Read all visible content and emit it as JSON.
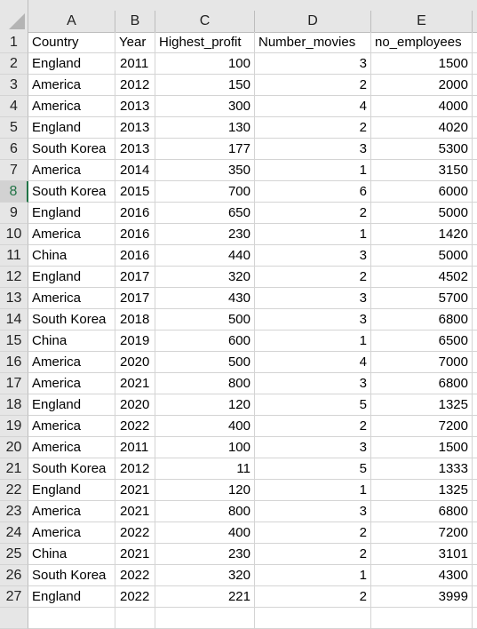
{
  "columns": [
    "A",
    "B",
    "C",
    "D",
    "E"
  ],
  "active_row": 8,
  "headers": [
    "Country",
    "Year",
    "Highest_profit",
    "Number_movies",
    "no_employees"
  ],
  "rows": [
    {
      "n": "2",
      "country": "England",
      "year": "2011",
      "profit": "100",
      "movies": "3",
      "employees": "1500"
    },
    {
      "n": "3",
      "country": "America",
      "year": "2012",
      "profit": "150",
      "movies": "2",
      "employees": "2000"
    },
    {
      "n": "4",
      "country": "America",
      "year": "2013",
      "profit": "300",
      "movies": "4",
      "employees": "4000"
    },
    {
      "n": "5",
      "country": "England",
      "year": "2013",
      "profit": "130",
      "movies": "2",
      "employees": "4020"
    },
    {
      "n": "6",
      "country": "South Korea",
      "year": "2013",
      "profit": "177",
      "movies": "3",
      "employees": "5300"
    },
    {
      "n": "7",
      "country": "America",
      "year": "2014",
      "profit": "350",
      "movies": "1",
      "employees": "3150"
    },
    {
      "n": "8",
      "country": "South Korea",
      "year": "2015",
      "profit": "700",
      "movies": "6",
      "employees": "6000"
    },
    {
      "n": "9",
      "country": "England",
      "year": "2016",
      "profit": "650",
      "movies": "2",
      "employees": "5000"
    },
    {
      "n": "10",
      "country": "America",
      "year": "2016",
      "profit": "230",
      "movies": "1",
      "employees": "1420"
    },
    {
      "n": "11",
      "country": "China",
      "year": "2016",
      "profit": "440",
      "movies": "3",
      "employees": "5000"
    },
    {
      "n": "12",
      "country": "England",
      "year": "2017",
      "profit": "320",
      "movies": "2",
      "employees": "4502"
    },
    {
      "n": "13",
      "country": "America",
      "year": "2017",
      "profit": "430",
      "movies": "3",
      "employees": "5700"
    },
    {
      "n": "14",
      "country": "South Korea",
      "year": "2018",
      "profit": "500",
      "movies": "3",
      "employees": "6800"
    },
    {
      "n": "15",
      "country": "China",
      "year": "2019",
      "profit": "600",
      "movies": "1",
      "employees": "6500"
    },
    {
      "n": "16",
      "country": "America",
      "year": "2020",
      "profit": "500",
      "movies": "4",
      "employees": "7000"
    },
    {
      "n": "17",
      "country": "America",
      "year": "2021",
      "profit": "800",
      "movies": "3",
      "employees": "6800"
    },
    {
      "n": "18",
      "country": "England",
      "year": "2020",
      "profit": "120",
      "movies": "5",
      "employees": "1325"
    },
    {
      "n": "19",
      "country": "America",
      "year": "2022",
      "profit": "400",
      "movies": "2",
      "employees": "7200"
    },
    {
      "n": "20",
      "country": "America",
      "year": "2011",
      "profit": "100",
      "movies": "3",
      "employees": "1500"
    },
    {
      "n": "21",
      "country": "South Korea",
      "year": "2012",
      "profit": "11",
      "movies": "5",
      "employees": "1333"
    },
    {
      "n": "22",
      "country": "England",
      "year": "2021",
      "profit": "120",
      "movies": "1",
      "employees": "1325"
    },
    {
      "n": "23",
      "country": "America",
      "year": "2021",
      "profit": "800",
      "movies": "3",
      "employees": "6800"
    },
    {
      "n": "24",
      "country": "America",
      "year": "2022",
      "profit": "400",
      "movies": "2",
      "employees": "7200"
    },
    {
      "n": "25",
      "country": "China",
      "year": "2021",
      "profit": "230",
      "movies": "2",
      "employees": "3101"
    },
    {
      "n": "26",
      "country": "South Korea",
      "year": "2022",
      "profit": "320",
      "movies": "1",
      "employees": "4300"
    },
    {
      "n": "27",
      "country": "England",
      "year": "2022",
      "profit": "221",
      "movies": "2",
      "employees": "3999"
    }
  ]
}
